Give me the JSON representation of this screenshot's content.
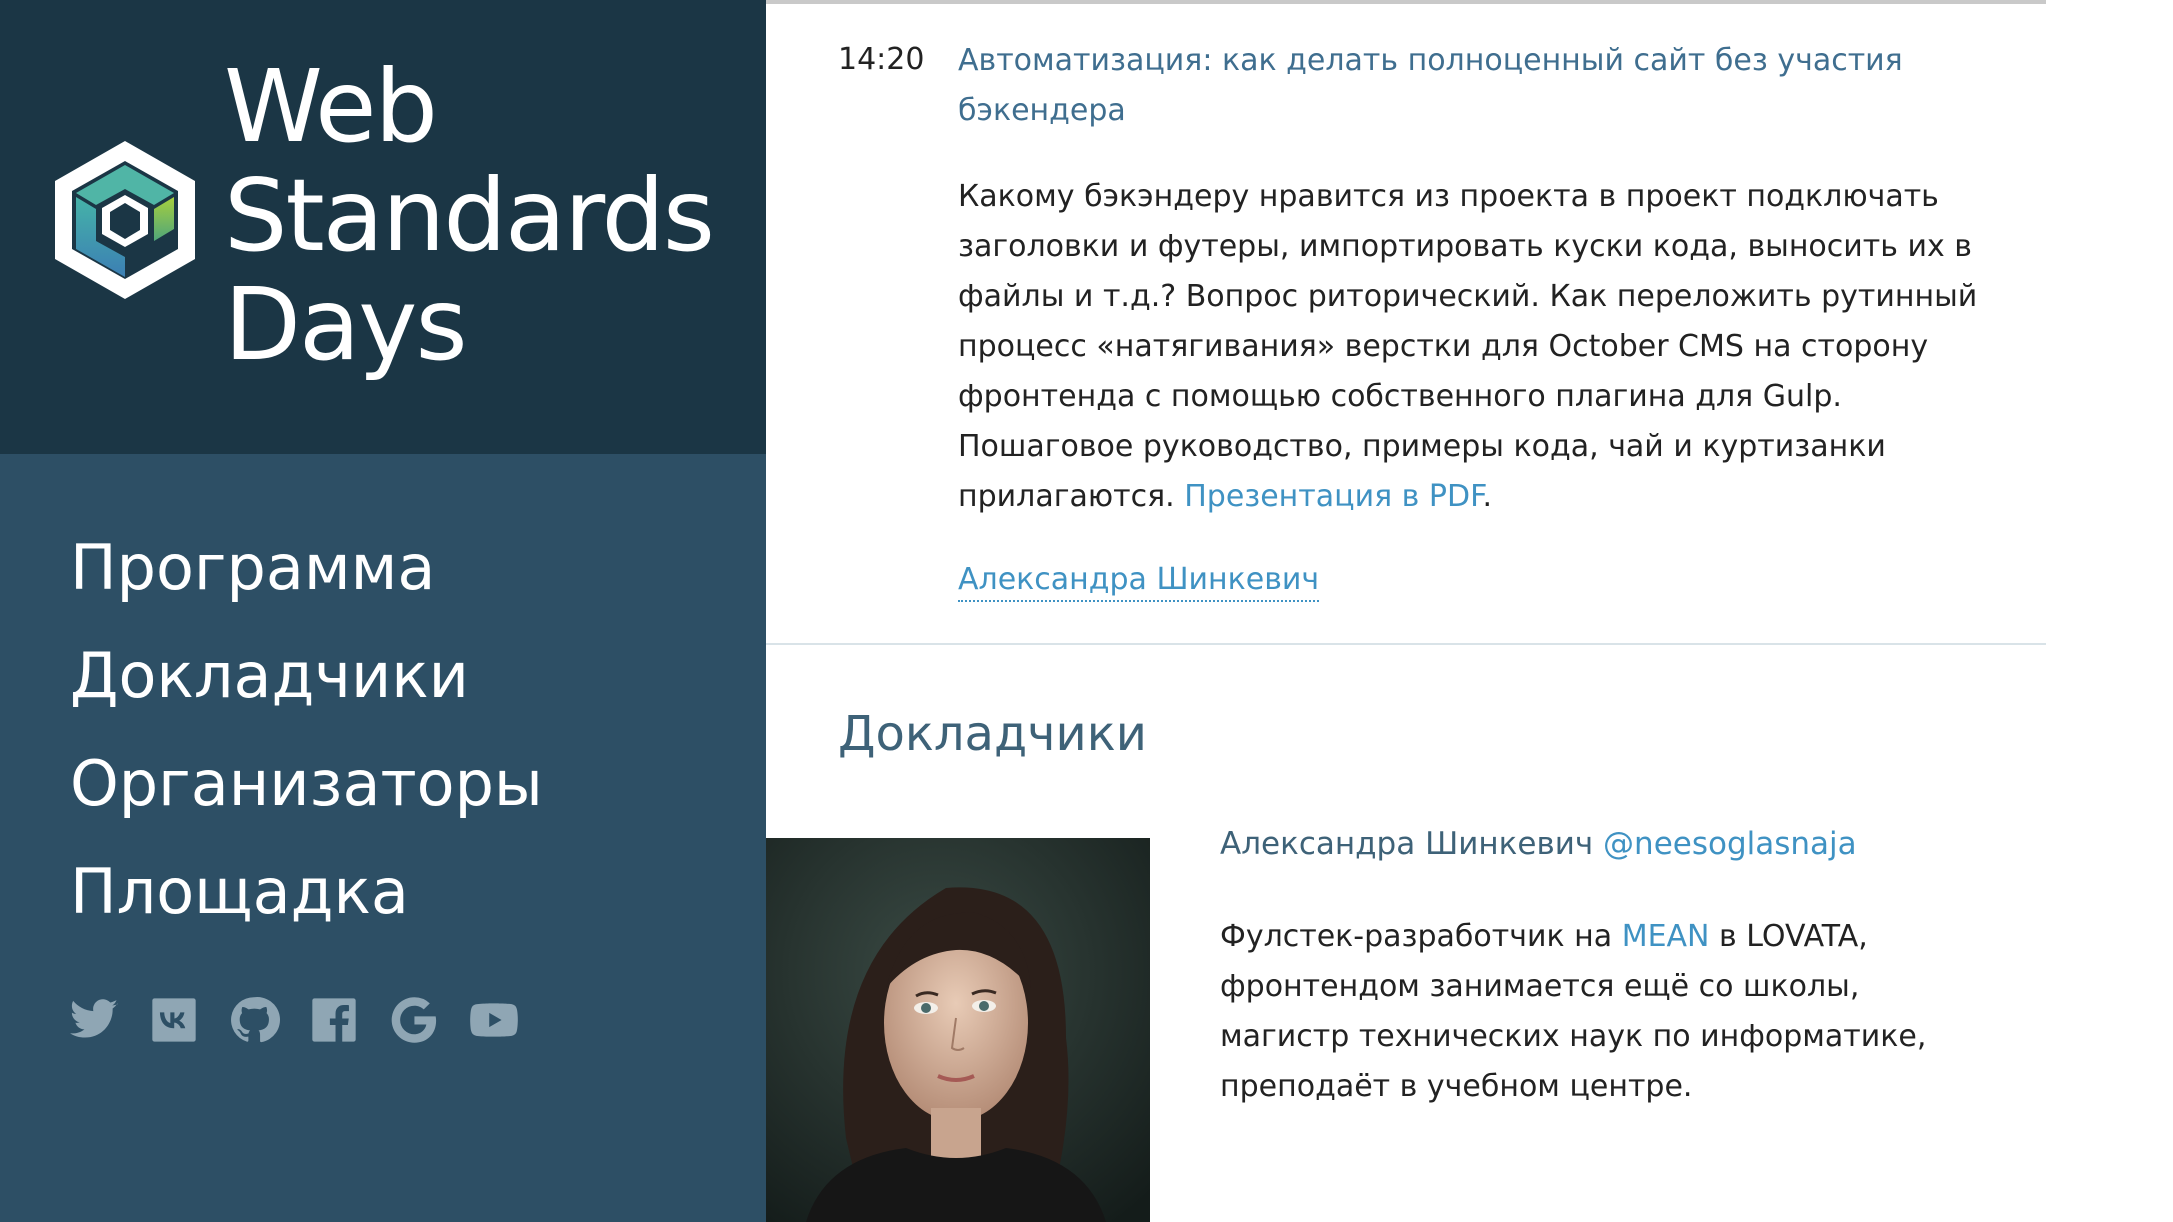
{
  "brand": {
    "line1": "Web",
    "line2": "Standards",
    "line3": "Days",
    "logo_icon": "cube-logo-icon",
    "colors": {
      "brand_bg": "#1b3645",
      "sidebar_bg": "#2d4f65",
      "accent": "#3f92c3"
    }
  },
  "nav": {
    "items": [
      {
        "label": "Программа"
      },
      {
        "label": "Докладчики"
      },
      {
        "label": "Организаторы"
      },
      {
        "label": "Площадка"
      }
    ]
  },
  "socials": {
    "items": [
      {
        "icon": "twitter-icon"
      },
      {
        "icon": "vk-icon"
      },
      {
        "icon": "github-icon"
      },
      {
        "icon": "facebook-icon"
      },
      {
        "icon": "google-icon"
      },
      {
        "icon": "youtube-icon"
      }
    ]
  },
  "talk": {
    "time": "14:20",
    "title": "Автоматизация: как делать полноценный сайт без участия бэкендера",
    "description": "Какому бэкэндеру нравится из проекта в проект подключать заголовки и футеры, импортировать куски кода, выносить их в файлы и т.д.? Вопрос риторический. Как переложить рутинный процесс «натягивания» верстки для October CMS на сторону фронтенда с помощью собственного плагина для Gulp. Пошаговое руководство, примеры кода, чай и куртизанки прилагаются.",
    "presentation_link": "Презентация в PDF",
    "trailing_period": ".",
    "speaker": "Александра Шинкевич"
  },
  "speakers_section": {
    "heading": "Докладчики",
    "speaker": {
      "name": "Александра Шинкевич",
      "handle": "@neesoglasnaja",
      "bio_before": "Фулстек-разработчик на ",
      "bio_link": "MEAN",
      "bio_after": " в LOVATA, фронтендом занимается ещё со школы, магистр технических наук по информатике, преподаёт в учебном центре."
    }
  }
}
